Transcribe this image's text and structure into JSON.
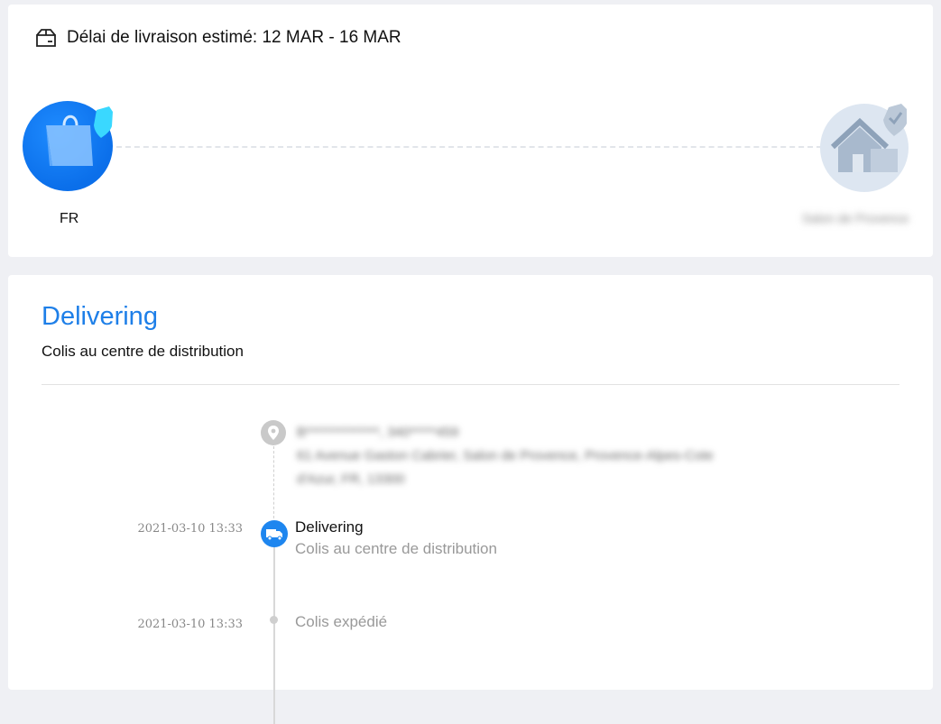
{
  "delivery": {
    "eta_label": "Délai de livraison estimé: 12 MAR - 16 MAR",
    "origin_label": "FR",
    "destination_label": "Salon de Provence"
  },
  "status": {
    "title": "Delivering",
    "subtitle": "Colis au centre de distribution",
    "title_color": "#1e7fe8"
  },
  "address": {
    "line1": "B**************, 340*****459",
    "line2": "61 Avenue Gaston Cabrier, Salon de Provence, Provence-Alpes-Cote",
    "line3": "d'Azur, FR, 13300"
  },
  "timeline": [
    {
      "time": "2021-03-10 13:33",
      "title": "Delivering",
      "description": "Colis au centre de distribution",
      "icon": "truck-icon"
    },
    {
      "time": "2021-03-10 13:33",
      "title": "",
      "description": "Colis expédié",
      "icon": "dot-icon"
    }
  ],
  "icons": {
    "eta": "shipping-box-icon",
    "origin": "shopping-bag-icon",
    "destination": "house-icon",
    "address": "location-pin-icon"
  }
}
